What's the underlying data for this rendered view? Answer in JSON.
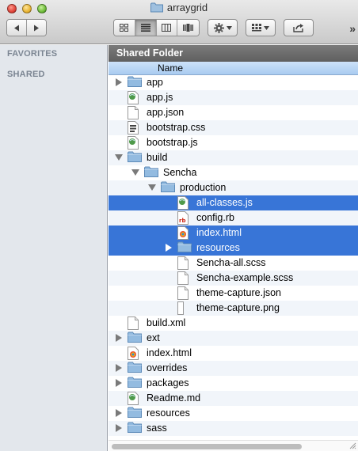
{
  "window": {
    "title": "arraygrid"
  },
  "toolbar": {
    "view_modes": [
      "icon-view",
      "list-view",
      "column-view",
      "cover-flow-view"
    ],
    "active_view": "list-view",
    "more": "»"
  },
  "sidebar": {
    "sections": [
      {
        "label": "FAVORITES"
      },
      {
        "label": "SHARED"
      }
    ]
  },
  "main": {
    "path_title": "Shared Folder",
    "column_header": "Name"
  },
  "files": [
    {
      "name": "app",
      "type": "folder",
      "depth": 0,
      "disclosure": "closed",
      "selected": false
    },
    {
      "name": "app.js",
      "type": "js",
      "depth": 0,
      "disclosure": "none",
      "selected": false
    },
    {
      "name": "app.json",
      "type": "doc",
      "depth": 0,
      "disclosure": "none",
      "selected": false
    },
    {
      "name": "bootstrap.css",
      "type": "css",
      "depth": 0,
      "disclosure": "none",
      "selected": false
    },
    {
      "name": "bootstrap.js",
      "type": "js",
      "depth": 0,
      "disclosure": "none",
      "selected": false
    },
    {
      "name": "build",
      "type": "folder",
      "depth": 0,
      "disclosure": "open",
      "selected": false
    },
    {
      "name": "Sencha",
      "type": "folder",
      "depth": 1,
      "disclosure": "open",
      "selected": false
    },
    {
      "name": "production",
      "type": "folder",
      "depth": 2,
      "disclosure": "open",
      "selected": false
    },
    {
      "name": "all-classes.js",
      "type": "js",
      "depth": 3,
      "disclosure": "none",
      "selected": true
    },
    {
      "name": "config.rb",
      "type": "rb",
      "depth": 3,
      "disclosure": "none",
      "selected": false
    },
    {
      "name": "index.html",
      "type": "html",
      "depth": 3,
      "disclosure": "none",
      "selected": true
    },
    {
      "name": "resources",
      "type": "folder",
      "depth": 3,
      "disclosure": "closed",
      "selected": true
    },
    {
      "name": "Sencha-all.scss",
      "type": "doc",
      "depth": 3,
      "disclosure": "none",
      "selected": false
    },
    {
      "name": "Sencha-example.scss",
      "type": "doc",
      "depth": 3,
      "disclosure": "none",
      "selected": false
    },
    {
      "name": "theme-capture.json",
      "type": "doc",
      "depth": 3,
      "disclosure": "none",
      "selected": false
    },
    {
      "name": "theme-capture.png",
      "type": "png",
      "depth": 3,
      "disclosure": "none",
      "selected": false
    },
    {
      "name": "build.xml",
      "type": "doc",
      "depth": 0,
      "disclosure": "none",
      "selected": false
    },
    {
      "name": "ext",
      "type": "folder",
      "depth": 0,
      "disclosure": "closed",
      "selected": false
    },
    {
      "name": "index.html",
      "type": "html",
      "depth": 0,
      "disclosure": "none",
      "selected": false
    },
    {
      "name": "overrides",
      "type": "folder",
      "depth": 0,
      "disclosure": "closed",
      "selected": false
    },
    {
      "name": "packages",
      "type": "folder",
      "depth": 0,
      "disclosure": "closed",
      "selected": false
    },
    {
      "name": "Readme.md",
      "type": "js",
      "depth": 0,
      "disclosure": "none",
      "selected": false
    },
    {
      "name": "resources",
      "type": "folder",
      "depth": 0,
      "disclosure": "closed",
      "selected": false
    },
    {
      "name": "sass",
      "type": "folder",
      "depth": 0,
      "disclosure": "closed",
      "selected": false
    }
  ],
  "colors": {
    "selection": "#3875d7",
    "folder": "#8db6dc",
    "sidebar_bg": "#e3e7ec",
    "header_bg": "#6b6b6b"
  }
}
